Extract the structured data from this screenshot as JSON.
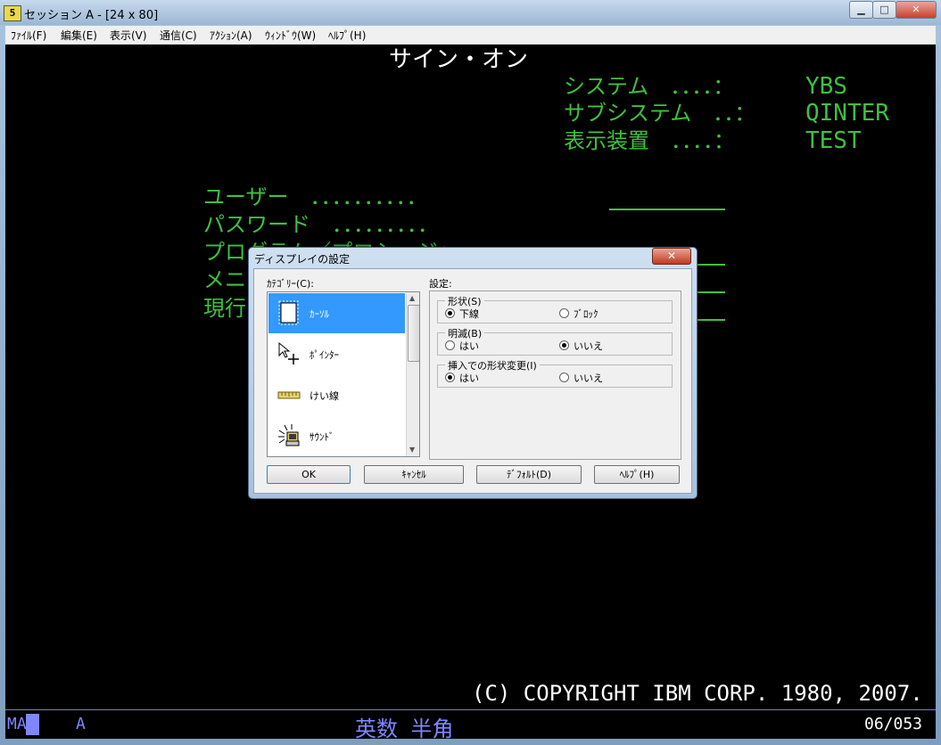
{
  "window": {
    "icon_text": "5",
    "title": "セッション A - [24 x 80]",
    "buttons": {
      "minimize": "▁",
      "maximize": "□",
      "close": "✕"
    }
  },
  "menu": [
    "ﾌｧｲﾙ(F)",
    "編集(E)",
    "表示(V)",
    "通信(C)",
    "ｱｸｼｮﾝ(A)",
    "ｳｨﾝﾄﾞｳ(W)",
    "ﾍﾙﾌﾟ(H)"
  ],
  "terminal": {
    "heading": "サイン・オン",
    "sys_rows": [
      {
        "label": "システム　．．．．：",
        "value": "YBS"
      },
      {
        "label": "サブシステム　．．：",
        "value": "QINTER"
      },
      {
        "label": "表示装置　．．．．：",
        "value": "TEST"
      }
    ],
    "fields": [
      "ユーザー　．．．．．．．．．．",
      "パスワード　．．．．．．．．．",
      "プログラム／プロシージャー",
      "メニュー",
      "現行ライブラリー"
    ],
    "copyright": "(C) COPYRIGHT IBM CORP. 1980, 2007."
  },
  "statusbar": {
    "mode": "MA",
    "indicator": "A",
    "input_mode": "英数 半角",
    "position": "06/053"
  },
  "colors": {
    "terminal_green": "#3fc13f",
    "status_blue": "#7f86ff",
    "selection": "#3399ff"
  },
  "dialog": {
    "title": "ディスプレイの設定",
    "close": "✕",
    "category_label": "ｶﾃｺﾞﾘｰ(C):",
    "settings_label": "設定:",
    "categories": [
      {
        "label": "ｶｰｿﾙ",
        "icon": "cursor-box-icon",
        "selected": true
      },
      {
        "label": "ﾎﾟｲﾝﾀｰ",
        "icon": "pointer-icon",
        "selected": false
      },
      {
        "label": "けい線",
        "icon": "ruler-icon",
        "selected": false
      },
      {
        "label": "ｻｳﾝﾄﾞ",
        "icon": "sound-icon",
        "selected": false
      }
    ],
    "groups": [
      {
        "legend": "形状(S)",
        "options": [
          {
            "label": "下線",
            "checked": true
          },
          {
            "label": "ﾌﾞﾛｯｸ",
            "checked": false
          }
        ]
      },
      {
        "legend": "明滅(B)",
        "options": [
          {
            "label": "はい",
            "checked": false
          },
          {
            "label": "いいえ",
            "checked": true
          }
        ]
      },
      {
        "legend": "挿入での形状変更(I)",
        "options": [
          {
            "label": "はい",
            "checked": true
          },
          {
            "label": "いいえ",
            "checked": false
          }
        ]
      }
    ],
    "buttons": {
      "ok": "OK",
      "cancel": "ｷｬﾝｾﾙ",
      "default": "ﾃﾞﾌｫﾙﾄ(D)",
      "help": "ﾍﾙﾌﾟ(H)"
    }
  }
}
